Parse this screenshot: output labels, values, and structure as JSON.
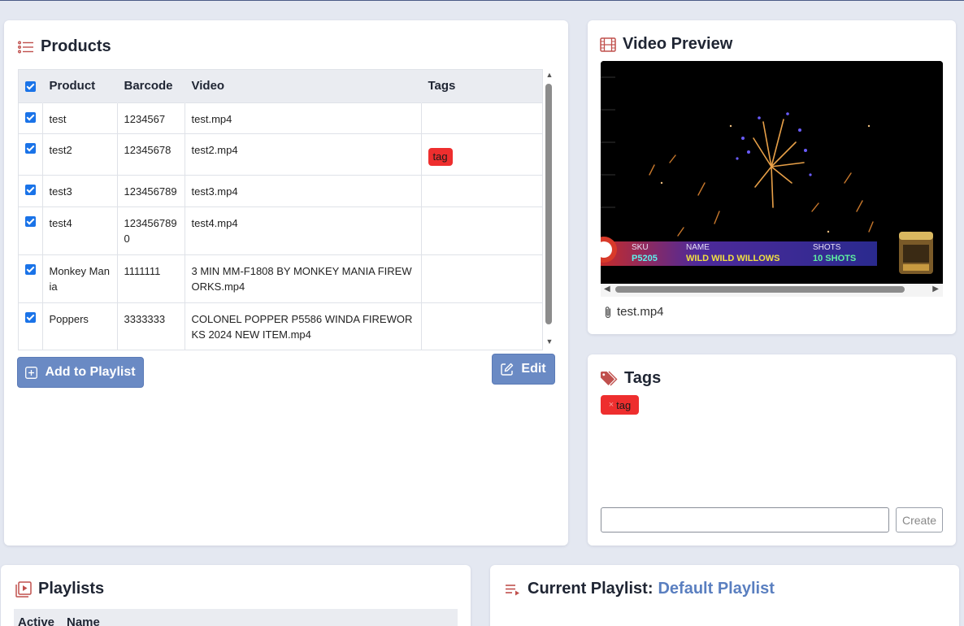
{
  "products": {
    "title": "Products",
    "columns": [
      "Product",
      "Barcode",
      "Video",
      "Tags"
    ],
    "rows": [
      {
        "product": "test",
        "barcode": "1234567",
        "video": "test.mp4",
        "tag": ""
      },
      {
        "product": "test2",
        "barcode": "12345678",
        "video": "test2.mp4",
        "tag": "tag"
      },
      {
        "product": "test3",
        "barcode": "123456789",
        "video": "test3.mp4",
        "tag": ""
      },
      {
        "product": "test4",
        "barcode": "1234567890",
        "video": "test4.mp4",
        "tag": ""
      },
      {
        "product": "Monkey Mania",
        "barcode": "1111111",
        "video": "3 MIN MM-F1808 BY MONKEY MANIA FIREWORKS.mp4",
        "tag": ""
      },
      {
        "product": "Poppers",
        "barcode": "3333333",
        "video": "COLONEL POPPER P5586 WINDA FIREWORKS 2024 NEW ITEM.mp4",
        "tag": ""
      }
    ],
    "add_button": "Add to Playlist",
    "edit_button": "Edit"
  },
  "video": {
    "title": "Video Preview",
    "file_name": "test.mp4",
    "overlay": {
      "sku_label": "SKU",
      "sku_value": "P5205",
      "name_label": "NAME",
      "name_value": "WILD WILD WILLOWS",
      "shots_label": "SHOTS",
      "shots_value": "10 SHOTS"
    }
  },
  "tags": {
    "title": "Tags",
    "items": [
      "tag"
    ],
    "input_value": "",
    "create_button": "Create"
  },
  "playlists": {
    "title": "Playlists",
    "columns": [
      "Active",
      "Name"
    ]
  },
  "current_playlist": {
    "label": "Current Playlist:",
    "name": "Default Playlist"
  },
  "colors": {
    "accent": "#5a7fc0",
    "button": "#6a8ac4",
    "tag_red": "#ee2e2e",
    "icon_red": "#c0504d"
  }
}
